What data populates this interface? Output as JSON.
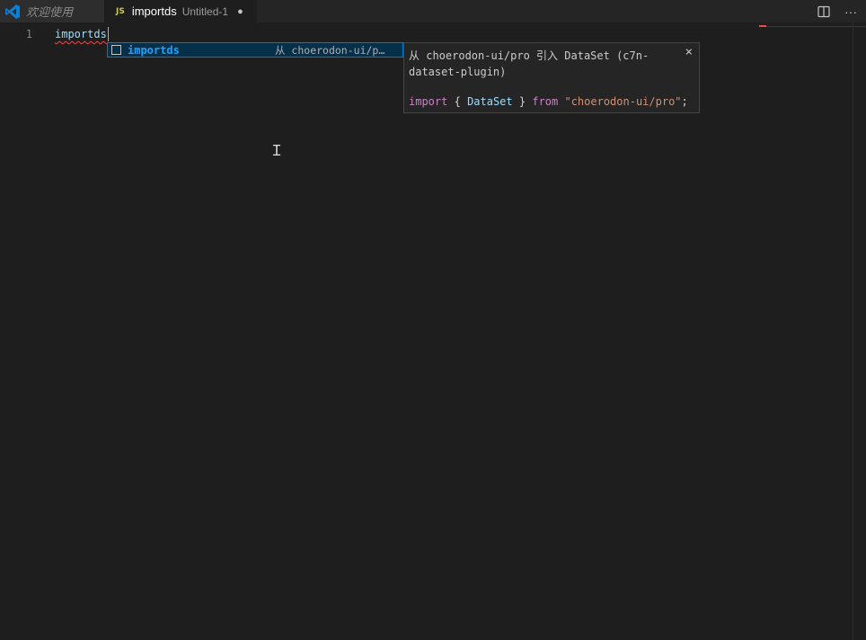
{
  "tabs": {
    "welcome_label": "欢迎使用",
    "active": {
      "badge": "JS",
      "filename": "importds",
      "description": "Untitled-1",
      "dirty_indicator": "●"
    }
  },
  "toolbar": {
    "split_icon": "split-editor-icon",
    "more_label": "···"
  },
  "editor": {
    "line_number": "1",
    "code": "importds"
  },
  "suggestion": {
    "label": "importds",
    "detail": "从 choerodon-ui/p…",
    "icon": "snippet-icon"
  },
  "details": {
    "close": "×",
    "title": "从 choerodon-ui/pro 引入 DataSet (c7n-dataset-plugin)",
    "code": {
      "kw_import": "import",
      "open_brace": "{",
      "name": "DataSet",
      "close_brace": "}",
      "kw_from": "from",
      "module": "\"choerodon-ui/pro\"",
      "semicolon": ";"
    }
  },
  "colors": {
    "background": "#1e1e1e",
    "accent": "#007acc",
    "error": "#f14c4c"
  }
}
